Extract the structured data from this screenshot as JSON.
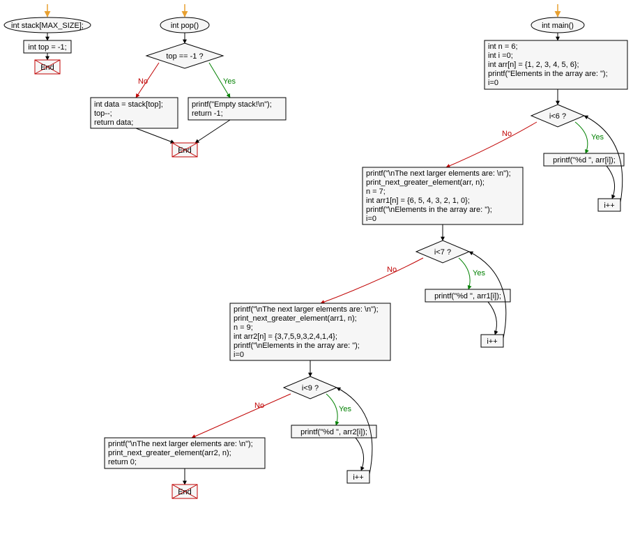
{
  "chart_data": {
    "type": "flowchart",
    "subcharts": [
      {
        "name": "stack-declaration",
        "nodes": [
          {
            "id": "stack_decl",
            "shape": "ellipse",
            "text": "int stack[MAX_SIZE];"
          },
          {
            "id": "top_init",
            "shape": "rect",
            "text": "int top = -1;"
          },
          {
            "id": "end1",
            "shape": "end",
            "text": "End"
          }
        ],
        "edges": [
          {
            "from": "entry",
            "to": "stack_decl"
          },
          {
            "from": "stack_decl",
            "to": "top_init"
          },
          {
            "from": "top_init",
            "to": "end1"
          }
        ]
      },
      {
        "name": "pop-function",
        "nodes": [
          {
            "id": "pop_decl",
            "shape": "ellipse",
            "text": "int pop()"
          },
          {
            "id": "pop_cond",
            "shape": "diamond",
            "text": "top == -1 ?"
          },
          {
            "id": "pop_no",
            "shape": "rect",
            "text": "int data = stack[top];\ntop--;\nreturn data;"
          },
          {
            "id": "pop_yes",
            "shape": "rect",
            "text": "printf(\"Empty stack!\\n\");\nreturn -1;"
          },
          {
            "id": "end2",
            "shape": "end",
            "text": "End"
          }
        ],
        "edges": [
          {
            "from": "entry",
            "to": "pop_decl"
          },
          {
            "from": "pop_decl",
            "to": "pop_cond"
          },
          {
            "from": "pop_cond",
            "to": "pop_no",
            "label": "No"
          },
          {
            "from": "pop_cond",
            "to": "pop_yes",
            "label": "Yes"
          },
          {
            "from": "pop_no",
            "to": "end2"
          },
          {
            "from": "pop_yes",
            "to": "end2"
          }
        ]
      },
      {
        "name": "main-function",
        "nodes": [
          {
            "id": "main_decl",
            "shape": "ellipse",
            "text": "int main()"
          },
          {
            "id": "main_init",
            "shape": "rect",
            "text": "int n = 6;\nint i =0;\nint arr[n] = {1, 2, 3, 4, 5, 6};\nprintf(\"Elements in the array are: \");\ni=0"
          },
          {
            "id": "cond1",
            "shape": "diamond",
            "text": "i<6 ?"
          },
          {
            "id": "print1",
            "shape": "rect",
            "text": "printf(\"%d \", arr[i]);"
          },
          {
            "id": "inc1",
            "shape": "rect",
            "text": "i++"
          },
          {
            "id": "block2",
            "shape": "rect",
            "text": "printf(\"\\nThe next larger elements are: \\n\");\nprint_next_greater_element(arr, n);\nn = 7;\nint arr1[n] = {6, 5, 4, 3, 2, 1, 0};\nprintf(\"\\nElements in the array are: \");\ni=0"
          },
          {
            "id": "cond2",
            "shape": "diamond",
            "text": "i<7 ?"
          },
          {
            "id": "print2",
            "shape": "rect",
            "text": "printf(\"%d \", arr1[i]);"
          },
          {
            "id": "inc2",
            "shape": "rect",
            "text": "i++"
          },
          {
            "id": "block3",
            "shape": "rect",
            "text": "printf(\"\\nThe next larger elements are: \\n\");\nprint_next_greater_element(arr1, n);\nn = 9;\nint arr2[n] = {3,7,5,9,3,2,4,1,4};\nprintf(\"\\nElements in the array are: \");\ni=0"
          },
          {
            "id": "cond3",
            "shape": "diamond",
            "text": "i<9 ?"
          },
          {
            "id": "print3",
            "shape": "rect",
            "text": "printf(\"%d \", arr2[i]);"
          },
          {
            "id": "inc3",
            "shape": "rect",
            "text": "i++"
          },
          {
            "id": "block4",
            "shape": "rect",
            "text": "printf(\"\\nThe next larger elements are: \\n\");\nprint_next_greater_element(arr2, n);\nreturn 0;"
          },
          {
            "id": "end3",
            "shape": "end",
            "text": "End"
          }
        ],
        "edges": [
          {
            "from": "entry",
            "to": "main_decl"
          },
          {
            "from": "main_decl",
            "to": "main_init"
          },
          {
            "from": "main_init",
            "to": "cond1"
          },
          {
            "from": "cond1",
            "to": "print1",
            "label": "Yes"
          },
          {
            "from": "print1",
            "to": "inc1"
          },
          {
            "from": "inc1",
            "to": "cond1"
          },
          {
            "from": "cond1",
            "to": "block2",
            "label": "No"
          },
          {
            "from": "block2",
            "to": "cond2"
          },
          {
            "from": "cond2",
            "to": "print2",
            "label": "Yes"
          },
          {
            "from": "print2",
            "to": "inc2"
          },
          {
            "from": "inc2",
            "to": "cond2"
          },
          {
            "from": "cond2",
            "to": "block3",
            "label": "No"
          },
          {
            "from": "block3",
            "to": "cond3"
          },
          {
            "from": "cond3",
            "to": "print3",
            "label": "Yes"
          },
          {
            "from": "print3",
            "to": "inc3"
          },
          {
            "from": "inc3",
            "to": "cond3"
          },
          {
            "from": "cond3",
            "to": "block4",
            "label": "No"
          },
          {
            "from": "block4",
            "to": "end3"
          }
        ]
      }
    ]
  },
  "labels": {
    "stack_decl": "int stack[MAX_SIZE];",
    "top_init": "int top = -1;",
    "end": "End",
    "pop_decl": "int pop()",
    "pop_cond": "top == -1 ?",
    "pop_no_l1": "int data = stack[top];",
    "pop_no_l2": "top--;",
    "pop_no_l3": "return data;",
    "pop_yes_l1": "printf(\"Empty stack!\\n\");",
    "pop_yes_l2": "return -1;",
    "main_decl": "int main()",
    "main_init_l1": "int n = 6;",
    "main_init_l2": "int i =0;",
    "main_init_l3": "int arr[n] = {1, 2, 3, 4, 5, 6};",
    "main_init_l4": "printf(\"Elements in the array are: \");",
    "main_init_l5": "i=0",
    "cond1": "i<6 ?",
    "print1": "printf(\"%d \", arr[i]);",
    "inc": "i++",
    "block2_l1": "printf(\"\\nThe next larger elements are: \\n\");",
    "block2_l2": "print_next_greater_element(arr, n);",
    "block2_l3": "n = 7;",
    "block2_l4": "int arr1[n] = {6, 5, 4, 3, 2, 1, 0};",
    "block2_l5": "printf(\"\\nElements in the array are: \");",
    "block2_l6": "i=0",
    "cond2": "i<7 ?",
    "print2": "printf(\"%d \", arr1[i]);",
    "block3_l1": "printf(\"\\nThe next larger elements are: \\n\");",
    "block3_l2": "print_next_greater_element(arr1, n);",
    "block3_l3": "n = 9;",
    "block3_l4": "int arr2[n] = {3,7,5,9,3,2,4,1,4};",
    "block3_l5": "printf(\"\\nElements in the array are: \");",
    "block3_l6": "i=0",
    "cond3": "i<9 ?",
    "print3": "printf(\"%d \", arr2[i]);",
    "block4_l1": "printf(\"\\nThe next larger elements are: \\n\");",
    "block4_l2": "print_next_greater_element(arr2, n);",
    "block4_l3": "return 0;",
    "yes": "Yes",
    "no": "No"
  }
}
